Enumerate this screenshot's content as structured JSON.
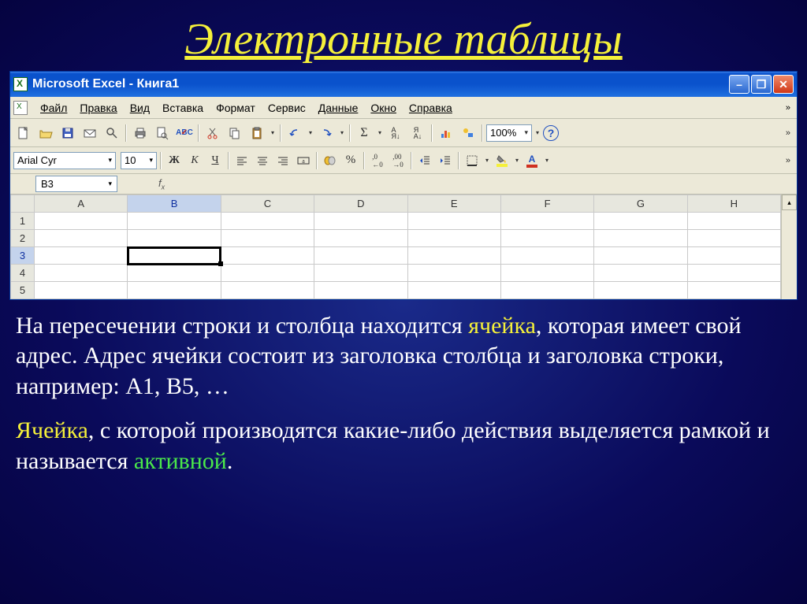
{
  "slide": {
    "title": "Электронные таблицы"
  },
  "window": {
    "title": "Microsoft Excel - Книга1",
    "menus": [
      "Файл",
      "Правка",
      "Вид",
      "Вставка",
      "Формат",
      "Сервис",
      "Данные",
      "Окно",
      "Справка"
    ],
    "zoom": "100%",
    "font_name": "Arial Cyr",
    "font_size": "10",
    "format_buttons": {
      "bold": "Ж",
      "italic": "К",
      "underline": "Ч"
    },
    "name_box": "B3",
    "fx_label": "fx",
    "columns": [
      "A",
      "B",
      "C",
      "D",
      "E",
      "F",
      "G",
      "H"
    ],
    "rows": [
      "1",
      "2",
      "3",
      "4",
      "5"
    ],
    "active_cell": {
      "col": "B",
      "row": "3"
    }
  },
  "paragraphs": {
    "p1_a": "На пересечении строки и столбца находится ",
    "p1_cell": "ячейка",
    "p1_b": ", которая имеет свой адрес. Адрес ячейки состоит из заголовка столбца  и заголовка строки, например: А1, В5, …",
    "p2_cell": "Ячейка",
    "p2_a": ",  с которой производятся какие-либо действия выделяется рамкой и называется ",
    "p2_active": "активной",
    "p2_b": "."
  }
}
